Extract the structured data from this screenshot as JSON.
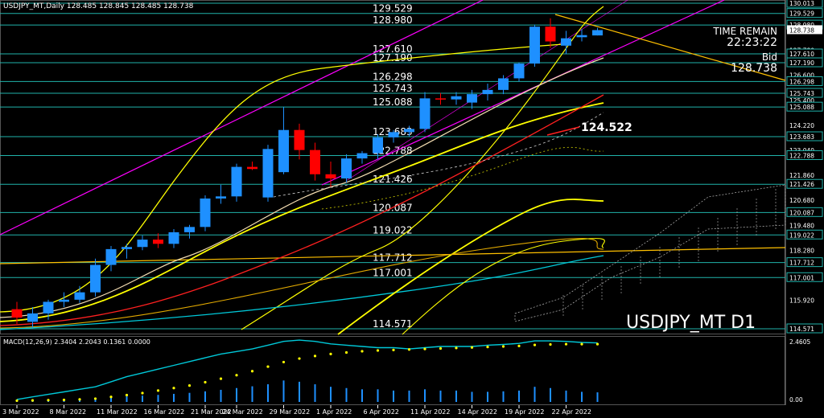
{
  "header": {
    "info": "USDJPY_MT,Daily  128.485 128.845 128.485 128.738"
  },
  "symbol_label": "USDJPY_MT D1",
  "time_remain": {
    "label": "TIME REMAIN",
    "value": "22:23:22"
  },
  "bid": {
    "label": "Bid",
    "value": "128.738"
  },
  "macd_label": "MACD(12,26,9) 2.3404 2.2043 0.1361 0.0000",
  "callout": {
    "value": "124.522",
    "price": 124.522
  },
  "colors": {
    "bull": "#1e90ff",
    "bear": "#ff0000",
    "level": "#20b2aa",
    "ma_yellow": "#ffff00",
    "ma_red": "#ff2020",
    "ma_cyan": "#00c8d8",
    "ma_white": "#f5deb3",
    "channel": "#ff00ff",
    "trend": "#ffc000",
    "macd_hist": "#1e90ff",
    "macd_signal": "#ffff00",
    "macd_line": "#00c8d8"
  },
  "chart_data": {
    "type": "candlestick",
    "x_dates": [
      "3 Mar 2022",
      "8 Mar 2022",
      "11 Mar 2022",
      "16 Mar 2022",
      "21 Mar 2022",
      "24 Mar 2022",
      "29 Mar 2022",
      "1 Apr 2022",
      "6 Apr 2022",
      "11 Apr 2022",
      "14 Apr 2022",
      "19 Apr 2022",
      "22 Apr 2022"
    ],
    "y_axis_labels": [
      "130.013",
      "129.529",
      "128.980",
      "128.738",
      "127.780",
      "127.610",
      "127.190",
      "126.600",
      "126.298",
      "125.743",
      "125.400",
      "125.088",
      "124.220",
      "123.683",
      "123.040",
      "122.788",
      "121.860",
      "121.426",
      "120.680",
      "120.087",
      "119.480",
      "119.022",
      "118.280",
      "117.712",
      "117.001",
      "115.920",
      "114.571"
    ],
    "levels": [
      {
        "price": 130.013,
        "label": ""
      },
      {
        "price": 129.529,
        "label": "129.529"
      },
      {
        "price": 128.98,
        "label": "128.980"
      },
      {
        "price": 127.61,
        "label": "127.610"
      },
      {
        "price": 127.19,
        "label": "127.190"
      },
      {
        "price": 126.298,
        "label": "126.298"
      },
      {
        "price": 125.743,
        "label": "125.743"
      },
      {
        "price": 125.088,
        "label": "125.088"
      },
      {
        "price": 123.683,
        "label": "123.683"
      },
      {
        "price": 122.788,
        "label": "122.788"
      },
      {
        "price": 121.426,
        "label": "121.426"
      },
      {
        "price": 120.087,
        "label": "120.087"
      },
      {
        "price": 119.022,
        "label": "119.022"
      },
      {
        "price": 117.712,
        "label": "117.712"
      },
      {
        "price": 117.001,
        "label": "117.001"
      },
      {
        "price": 114.571,
        "label": "114.571"
      }
    ],
    "candles": [
      {
        "o": 115.5,
        "h": 115.85,
        "l": 114.8,
        "c": 115.1
      },
      {
        "o": 114.9,
        "h": 115.6,
        "l": 114.6,
        "c": 115.3
      },
      {
        "o": 115.3,
        "h": 115.95,
        "l": 115.0,
        "c": 115.85
      },
      {
        "o": 115.85,
        "h": 116.3,
        "l": 115.6,
        "c": 115.95
      },
      {
        "o": 115.95,
        "h": 116.6,
        "l": 115.8,
        "c": 116.3
      },
      {
        "o": 116.3,
        "h": 117.9,
        "l": 116.1,
        "c": 117.6
      },
      {
        "o": 117.6,
        "h": 118.5,
        "l": 117.3,
        "c": 118.35
      },
      {
        "o": 118.35,
        "h": 118.6,
        "l": 117.9,
        "c": 118.45
      },
      {
        "o": 118.45,
        "h": 119.0,
        "l": 118.3,
        "c": 118.8
      },
      {
        "o": 118.8,
        "h": 119.1,
        "l": 118.4,
        "c": 118.6
      },
      {
        "o": 118.6,
        "h": 119.3,
        "l": 118.4,
        "c": 119.15
      },
      {
        "o": 119.15,
        "h": 119.5,
        "l": 118.85,
        "c": 119.4
      },
      {
        "o": 119.4,
        "h": 120.9,
        "l": 119.2,
        "c": 120.75
      },
      {
        "o": 120.75,
        "h": 121.4,
        "l": 120.5,
        "c": 120.85
      },
      {
        "o": 120.85,
        "h": 122.4,
        "l": 120.6,
        "c": 122.25
      },
      {
        "o": 122.25,
        "h": 122.5,
        "l": 122.1,
        "c": 122.15
      },
      {
        "o": 120.8,
        "h": 123.3,
        "l": 120.6,
        "c": 123.1
      },
      {
        "o": 122.0,
        "h": 125.1,
        "l": 121.9,
        "c": 124.0
      },
      {
        "o": 124.0,
        "h": 124.3,
        "l": 122.6,
        "c": 123.05
      },
      {
        "o": 123.05,
        "h": 123.4,
        "l": 121.6,
        "c": 121.9
      },
      {
        "o": 121.9,
        "h": 122.5,
        "l": 121.3,
        "c": 121.7
      },
      {
        "o": 121.7,
        "h": 122.85,
        "l": 121.5,
        "c": 122.65
      },
      {
        "o": 122.65,
        "h": 123.0,
        "l": 122.4,
        "c": 122.9
      },
      {
        "o": 122.9,
        "h": 123.8,
        "l": 122.6,
        "c": 123.65
      },
      {
        "o": 123.65,
        "h": 124.0,
        "l": 123.4,
        "c": 123.9
      },
      {
        "o": 123.9,
        "h": 124.2,
        "l": 123.7,
        "c": 124.05
      },
      {
        "o": 124.05,
        "h": 125.8,
        "l": 123.9,
        "c": 125.5
      },
      {
        "o": 125.5,
        "h": 125.75,
        "l": 125.2,
        "c": 125.45
      },
      {
        "o": 125.45,
        "h": 125.8,
        "l": 125.2,
        "c": 125.6
      },
      {
        "o": 125.3,
        "h": 125.9,
        "l": 125.0,
        "c": 125.7
      },
      {
        "o": 125.7,
        "h": 126.2,
        "l": 125.4,
        "c": 125.9
      },
      {
        "o": 125.9,
        "h": 126.6,
        "l": 125.7,
        "c": 126.45
      },
      {
        "o": 126.45,
        "h": 127.2,
        "l": 126.3,
        "c": 127.15
      },
      {
        "o": 127.15,
        "h": 129.0,
        "l": 127.0,
        "c": 128.9
      },
      {
        "o": 128.9,
        "h": 129.3,
        "l": 127.9,
        "c": 128.2
      },
      {
        "o": 128.0,
        "h": 128.7,
        "l": 127.6,
        "c": 128.35
      },
      {
        "o": 128.4,
        "h": 128.8,
        "l": 128.2,
        "c": 128.5
      },
      {
        "o": 128.485,
        "h": 128.845,
        "l": 128.485,
        "c": 128.738
      }
    ],
    "macd": {
      "y_labels": [
        "2.4605",
        "0.00"
      ],
      "hist": [
        0.05,
        0.06,
        0.07,
        0.08,
        0.1,
        0.14,
        0.18,
        0.22,
        0.25,
        0.28,
        0.32,
        0.36,
        0.42,
        0.48,
        0.55,
        0.62,
        0.7,
        0.85,
        0.8,
        0.7,
        0.6,
        0.55,
        0.5,
        0.5,
        0.45,
        0.45,
        0.5,
        0.45,
        0.45,
        0.4,
        0.4,
        0.42,
        0.45,
        0.6,
        0.55,
        0.45,
        0.4,
        0.38
      ],
      "signal": [
        0.05,
        0.06,
        0.07,
        0.08,
        0.1,
        0.13,
        0.2,
        0.27,
        0.35,
        0.45,
        0.55,
        0.65,
        0.78,
        0.92,
        1.06,
        1.22,
        1.4,
        1.58,
        1.72,
        1.82,
        1.9,
        1.96,
        2.01,
        2.04,
        2.06,
        2.08,
        2.1,
        2.12,
        2.14,
        2.16,
        2.18,
        2.2,
        2.22,
        2.26,
        2.28,
        2.29,
        2.29,
        2.29
      ],
      "line": [
        0.1,
        0.2,
        0.3,
        0.4,
        0.5,
        0.6,
        0.8,
        1.0,
        1.15,
        1.3,
        1.45,
        1.6,
        1.75,
        1.9,
        2.0,
        2.1,
        2.25,
        2.4,
        2.45,
        2.4,
        2.3,
        2.25,
        2.2,
        2.15,
        2.15,
        2.1,
        2.15,
        2.2,
        2.2,
        2.2,
        2.25,
        2.28,
        2.32,
        2.42,
        2.42,
        2.4,
        2.36,
        2.34
      ]
    }
  }
}
